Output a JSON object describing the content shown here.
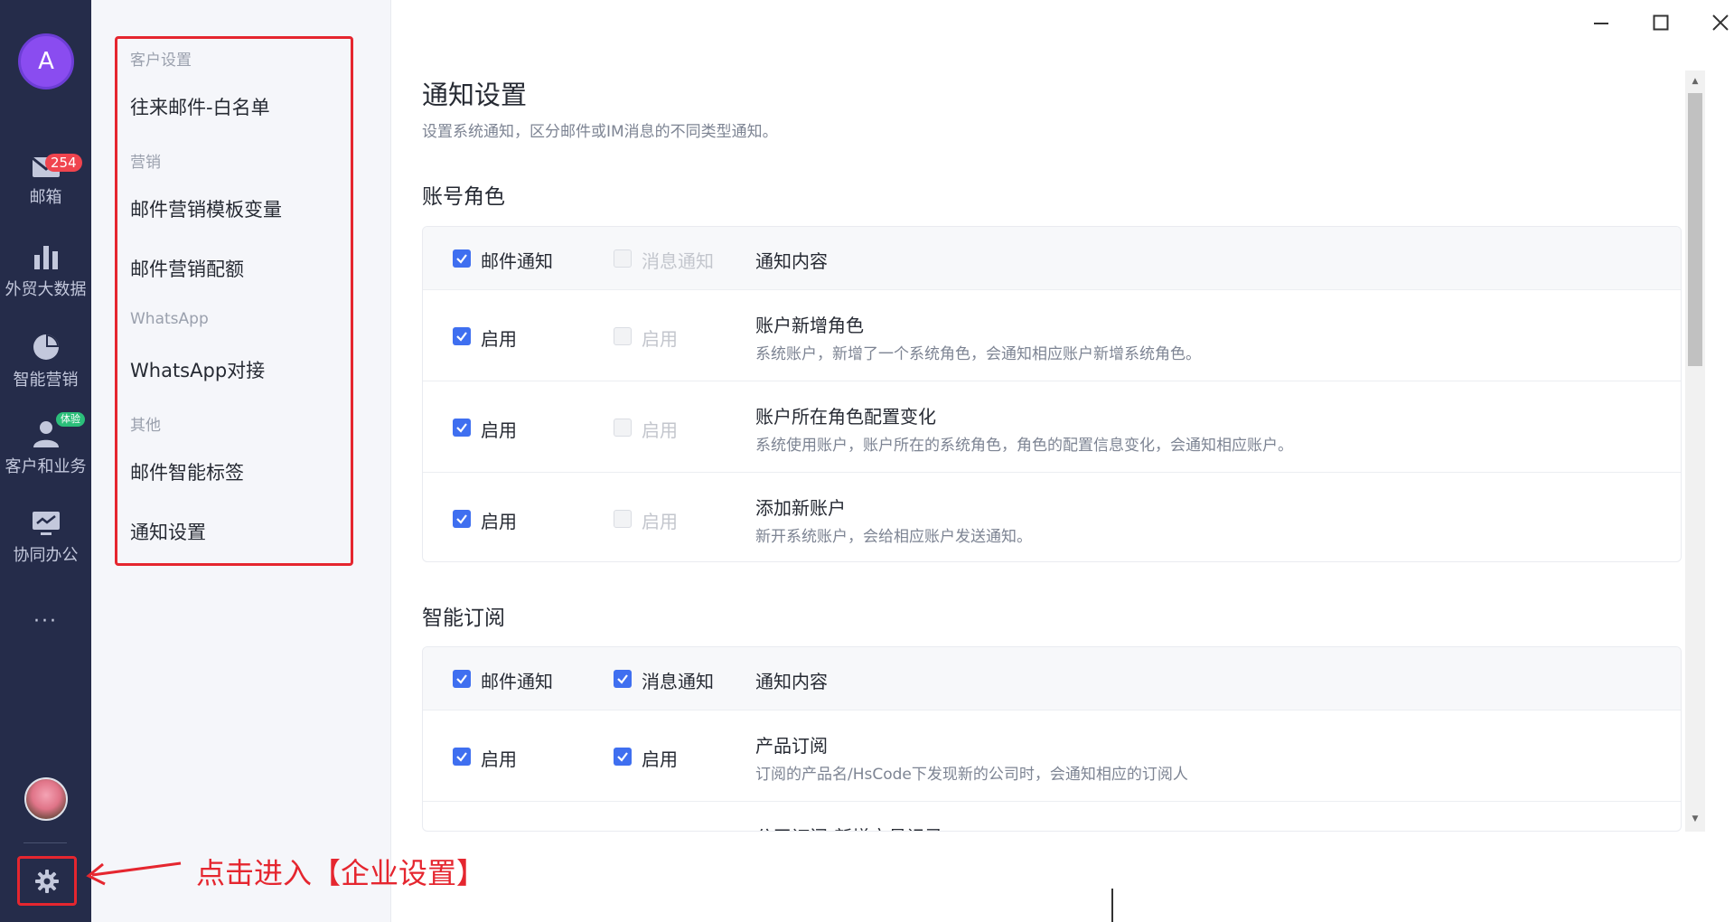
{
  "rail": {
    "avatar_letter": "A",
    "items": [
      {
        "label": "邮箱",
        "icon": "mail-icon",
        "badge": "254"
      },
      {
        "label": "外贸大数据",
        "icon": "bar-chart-icon"
      },
      {
        "label": "智能营销",
        "icon": "pie-chart-icon"
      },
      {
        "label": "客户和业务",
        "icon": "customer-icon",
        "badge": "体验"
      },
      {
        "label": "协同办公",
        "icon": "monitor-icon"
      }
    ],
    "more": "···",
    "settings_icon": "gear-icon"
  },
  "subnav": {
    "groups": [
      {
        "title": "客户设置",
        "items": [
          "往来邮件-白名单"
        ]
      },
      {
        "title": "营销",
        "items": [
          "邮件营销模板变量",
          "邮件营销配额"
        ]
      },
      {
        "title": "WhatsApp",
        "items": [
          "WhatsApp对接"
        ]
      },
      {
        "title": "其他",
        "items": [
          "邮件智能标签",
          "通知设置"
        ]
      }
    ]
  },
  "main": {
    "title": "通知设置",
    "description": "设置系统通知，区分邮件或IM消息的不同类型通知。",
    "sections": [
      {
        "title": "账号角色",
        "header": {
          "col1": "邮件通知",
          "col1_checked": true,
          "col2": "消息通知",
          "col2_checked": false,
          "col2_disabled": true,
          "col3": "通知内容"
        },
        "rows": [
          {
            "col1": "启用",
            "col1_checked": true,
            "col2": "启用",
            "col2_checked": false,
            "col2_disabled": true,
            "title": "账户新增角色",
            "desc": "系统账户，新增了一个系统角色，会通知相应账户新增系统角色。"
          },
          {
            "col1": "启用",
            "col1_checked": true,
            "col2": "启用",
            "col2_checked": false,
            "col2_disabled": true,
            "title": "账户所在角色配置变化",
            "desc": "系统使用账户，账户所在的系统角色，角色的配置信息变化，会通知相应账户。"
          },
          {
            "col1": "启用",
            "col1_checked": true,
            "col2": "启用",
            "col2_checked": false,
            "col2_disabled": true,
            "title": "添加新账户",
            "desc": "新开系统账户，会给相应账户发送通知。"
          }
        ]
      },
      {
        "title": "智能订阅",
        "header": {
          "col1": "邮件通知",
          "col1_checked": true,
          "col2": "消息通知",
          "col2_checked": true,
          "col2_disabled": false,
          "col3": "通知内容"
        },
        "rows": [
          {
            "col1": "启用",
            "col1_checked": true,
            "col2": "启用",
            "col2_checked": true,
            "col2_disabled": false,
            "title": "产品订阅",
            "desc": "订阅的产品名/HsCode下发现新的公司时，会通知相应的订阅人"
          },
          {
            "title": "公司订阅-新增交易记录"
          }
        ]
      }
    ]
  },
  "annotation": {
    "text": "点击进入【企业设置】",
    "color": "#e5262f"
  },
  "colors": {
    "rail_bg": "#252c4a",
    "accent": "#3f6ff0",
    "annotation": "#e5262f",
    "avatar": "#8a4cf0"
  }
}
